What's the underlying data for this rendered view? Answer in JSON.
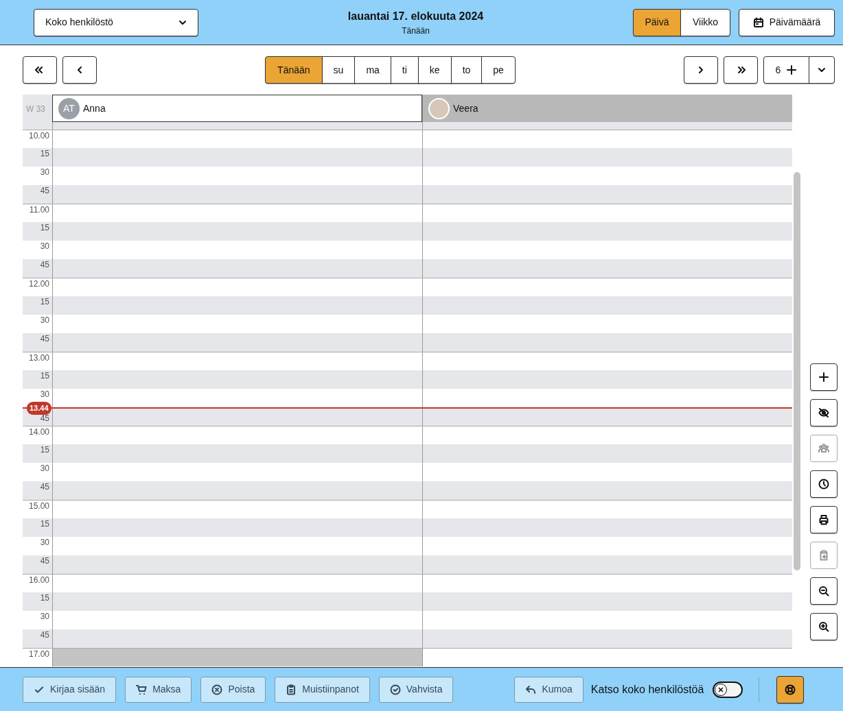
{
  "header": {
    "staff_select": "Koko henkilöstö",
    "date_title": "lauantai 17. elokuuta 2024",
    "date_subtitle": "Tänään",
    "views": [
      {
        "label": "Päivä",
        "selected": true
      },
      {
        "label": "Viikko",
        "selected": false
      }
    ],
    "date_button": "Päivämäärä"
  },
  "day_nav": [
    {
      "label": "Tänään",
      "selected": true
    },
    {
      "label": "su",
      "selected": false
    },
    {
      "label": "ma",
      "selected": false
    },
    {
      "label": "ti",
      "selected": false
    },
    {
      "label": "ke",
      "selected": false
    },
    {
      "label": "to",
      "selected": false
    },
    {
      "label": "pe",
      "selected": false
    }
  ],
  "columns_count": "6",
  "week": "W 33",
  "staff": [
    {
      "name": "Anna",
      "initials": "AT",
      "selected": true
    },
    {
      "name": "Veera",
      "selected": false
    }
  ],
  "rows": [
    {
      "label": "10.00",
      "kind": "hour",
      "blocked": [
        false,
        false
      ]
    },
    {
      "label": "15",
      "kind": "quarter",
      "blocked": [
        false,
        false
      ]
    },
    {
      "label": "30",
      "kind": "half",
      "blocked": [
        false,
        false
      ]
    },
    {
      "label": "45",
      "kind": "quarter",
      "blocked": [
        false,
        false
      ]
    },
    {
      "label": "11.00",
      "kind": "hour",
      "blocked": [
        false,
        false
      ]
    },
    {
      "label": "15",
      "kind": "quarter",
      "blocked": [
        false,
        false
      ]
    },
    {
      "label": "30",
      "kind": "half",
      "blocked": [
        false,
        false
      ]
    },
    {
      "label": "45",
      "kind": "quarter",
      "blocked": [
        false,
        false
      ]
    },
    {
      "label": "12.00",
      "kind": "hour",
      "blocked": [
        false,
        false
      ]
    },
    {
      "label": "15",
      "kind": "quarter",
      "blocked": [
        false,
        false
      ]
    },
    {
      "label": "30",
      "kind": "half",
      "blocked": [
        false,
        false
      ]
    },
    {
      "label": "45",
      "kind": "quarter",
      "blocked": [
        false,
        false
      ]
    },
    {
      "label": "13.00",
      "kind": "hour",
      "blocked": [
        false,
        false
      ]
    },
    {
      "label": "15",
      "kind": "quarter",
      "blocked": [
        false,
        false
      ]
    },
    {
      "label": "30",
      "kind": "half",
      "blocked": [
        false,
        false
      ]
    },
    {
      "label": "45",
      "kind": "quarter",
      "blocked": [
        false,
        false
      ],
      "now": "13.44"
    },
    {
      "label": "14.00",
      "kind": "hour",
      "blocked": [
        false,
        false
      ]
    },
    {
      "label": "15",
      "kind": "quarter",
      "blocked": [
        false,
        false
      ]
    },
    {
      "label": "30",
      "kind": "half",
      "blocked": [
        false,
        false
      ]
    },
    {
      "label": "45",
      "kind": "quarter",
      "blocked": [
        false,
        false
      ]
    },
    {
      "label": "15.00",
      "kind": "hour",
      "blocked": [
        false,
        false
      ]
    },
    {
      "label": "15",
      "kind": "quarter",
      "blocked": [
        false,
        false
      ]
    },
    {
      "label": "30",
      "kind": "half",
      "blocked": [
        false,
        false
      ]
    },
    {
      "label": "45",
      "kind": "quarter",
      "blocked": [
        false,
        false
      ]
    },
    {
      "label": "16.00",
      "kind": "hour",
      "blocked": [
        false,
        false
      ]
    },
    {
      "label": "15",
      "kind": "quarter",
      "blocked": [
        false,
        false
      ]
    },
    {
      "label": "30",
      "kind": "half",
      "blocked": [
        false,
        false
      ]
    },
    {
      "label": "45",
      "kind": "quarter",
      "blocked": [
        false,
        false
      ]
    },
    {
      "label": "17.00",
      "kind": "hour",
      "blocked": [
        true,
        false
      ]
    }
  ],
  "side_tools": [
    {
      "kind": "add",
      "disabled": false
    },
    {
      "kind": "hide",
      "disabled": false
    },
    {
      "kind": "group",
      "disabled": true
    },
    {
      "kind": "clock",
      "disabled": false
    },
    {
      "kind": "print",
      "disabled": false
    },
    {
      "kind": "paste",
      "disabled": true
    },
    {
      "kind": "zoom_out",
      "disabled": false
    },
    {
      "kind": "zoom_in",
      "disabled": false
    }
  ],
  "footer": {
    "actions": [
      {
        "kind": "check",
        "label": "Kirjaa sisään"
      },
      {
        "kind": "cart",
        "label": "Maksa"
      },
      {
        "kind": "remove",
        "label": "Poista"
      },
      {
        "kind": "notes",
        "label": "Muistiinpanot"
      },
      {
        "kind": "confirm",
        "label": "Vahvista"
      }
    ],
    "undo": "Kumoa",
    "toggle": {
      "label": "Katso koko henkilöstöä",
      "on": false
    }
  }
}
